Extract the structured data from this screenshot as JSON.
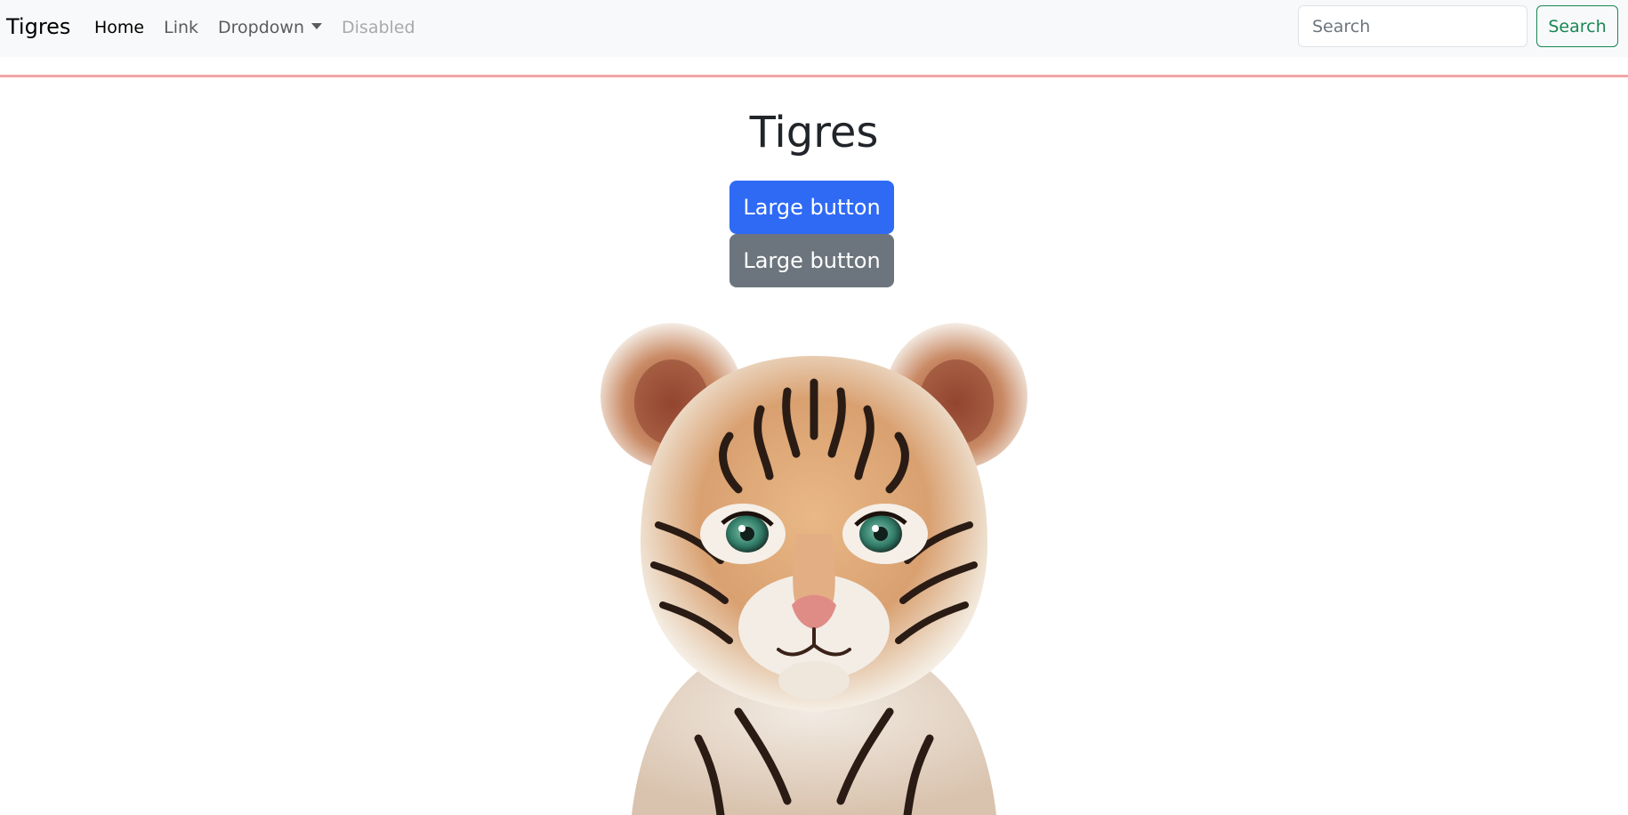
{
  "navbar": {
    "brand": "Tigres",
    "links": [
      {
        "label": "Home"
      },
      {
        "label": "Link"
      },
      {
        "label": "Dropdown"
      },
      {
        "label": "Disabled"
      }
    ],
    "search": {
      "placeholder": "Search",
      "value": "",
      "button_label": "Search"
    }
  },
  "main": {
    "title": "Tigres",
    "buttons": [
      {
        "label": "Large button",
        "style": "primary",
        "color": "#2f6af5"
      },
      {
        "label": "Large button",
        "style": "secondary",
        "color": "#6c757d"
      }
    ],
    "image": {
      "alt": "tiger cub portrait"
    }
  },
  "colors": {
    "navbar_bg": "#f8f9fa",
    "divider": "#f1a5a8",
    "search_button": "#198754"
  }
}
